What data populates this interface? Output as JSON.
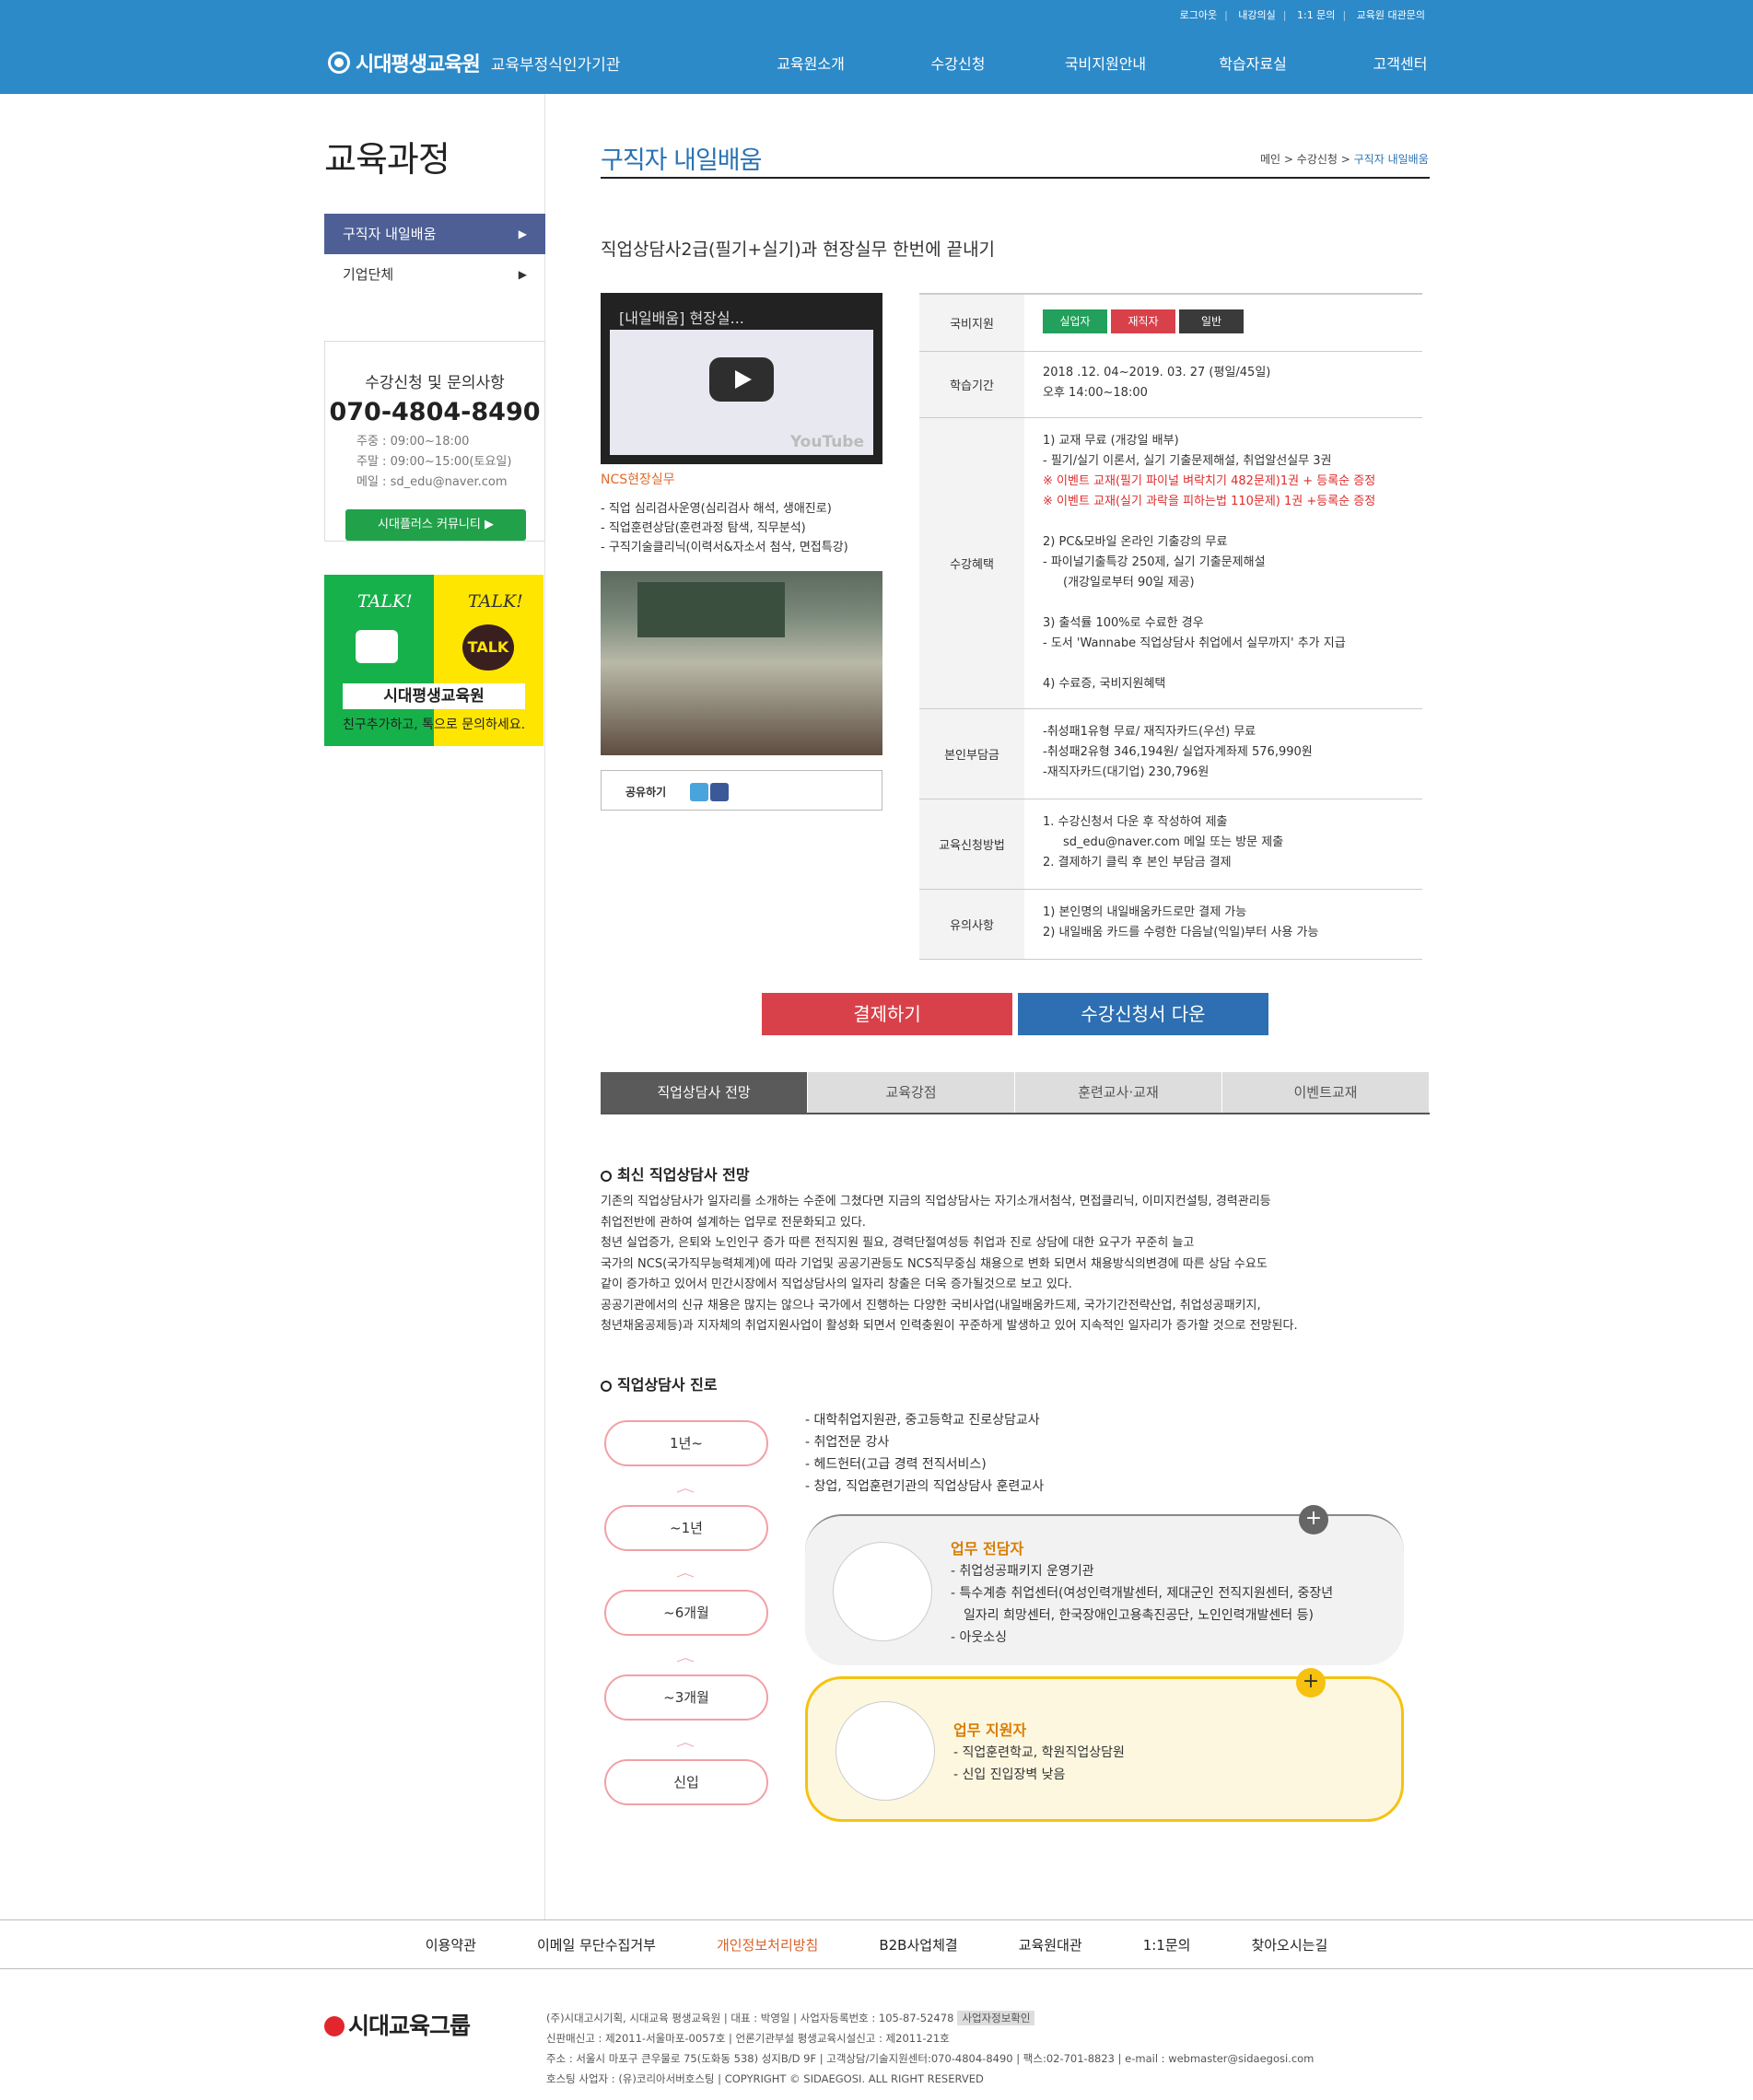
{
  "util": [
    "로그아웃",
    "내강의실",
    "1:1 문의",
    "교육원 대관문의"
  ],
  "logo": {
    "name": "시대평생교육원",
    "sub": "교육부정식인가기관"
  },
  "gnb": [
    "교육원소개",
    "수강신청",
    "국비지원안내",
    "학습자료실",
    "고객센터"
  ],
  "lnb": {
    "title": "교육과정",
    "items": [
      "구직자 내일배움",
      "기업단체"
    ]
  },
  "inquiry": {
    "title": "수강신청 및 문의사항",
    "phone": "070-4804-8490",
    "weekday": "주중 : 09:00~18:00",
    "weekend": "주말 : 09:00~15:00(토요일)",
    "email": "메일 : sd_edu@naver.com",
    "community": "시대플러스 커뮤니티 ▶"
  },
  "talk": {
    "left": "TALK!",
    "right": "TALK!",
    "icon": "TALK",
    "name": "시대평생교육원",
    "caption": "친구추가하고, 톡으로 문의하세요."
  },
  "page": {
    "title": "구직자 내일배움",
    "crumb": [
      "메인",
      "수강신청",
      "구직자 내일배움"
    ]
  },
  "course": {
    "title": "직업상담사2급(필기+실기)과 현장실무 한번에 끝내기",
    "video_title": "[내일배움] 현장실...",
    "ncs": "NCS현장실무",
    "list": [
      "- 직업 심리검사운영(심리검사 해석, 생애진로)",
      "- 직업훈련상담(훈련과정 탐색, 직무분석)",
      "- 구직기술클리닉(이력서&자소서 첨삭, 면접특강)"
    ],
    "share": "공유하기"
  },
  "info": {
    "support_label": "국비지원",
    "badges": [
      "실업자",
      "재직자",
      "일반"
    ],
    "period_label": "학습기간",
    "period": [
      "2018 .12. 04~2019. 03. 27 (평일/45일)",
      "오후 14:00~18:00"
    ],
    "benefit_label": "수강혜택",
    "benefit1": [
      "1) 교재 무료 (개강일 배부)",
      "- 필기/실기 이론서, 실기 기출문제해설, 취업알선실무 3권"
    ],
    "benefit1_red": [
      "※ 이벤트 교재(필기 파이널 벼락치기 482문제)1권 + 등록순 증정",
      "※ 이벤트 교재(실기 과락을 피하는법 110문제) 1권 +등록순 증정"
    ],
    "benefit2": [
      "2) PC&모바일 온라인 기출강의 무료",
      "- 파이널기출특강 250제, 실기 기출문제해설",
      "(개강일로부터 90일 제공)"
    ],
    "benefit3": [
      "3) 출석률 100%로 수료한 경우",
      "- 도서 'Wannabe 직업상담사 취업에서 실무까지' 추가 지급"
    ],
    "benefit4": "4) 수료증, 국비지원혜택",
    "cost_label": "본인부담금",
    "cost": [
      "-취성패1유형 무료/ 재직자카드(우선) 무료",
      "-취성패2유형 346,194원/ 실업자계좌제 576,990원",
      "-재직자카드(대기업) 230,796원"
    ],
    "apply_label": "교육신청방법",
    "apply": [
      "1. 수강신청서 다운 후 작성하여 제출",
      "sd_edu@naver.com 메일 또는 방문 제출",
      "2. 결제하기 클릭 후 본인 부담금 결제"
    ],
    "note_label": "유의사항",
    "note": [
      "1) 본인명의 내일배움카드로만 결제 가능",
      "2) 내일배움 카드를 수령한 다음날(익일)부터 사용 가능"
    ]
  },
  "buttons": {
    "pay": "결제하기",
    "download": "수강신청서 다운"
  },
  "tabs": [
    "직업상담사 전망",
    "교육강점",
    "훈련교사·교재",
    "이벤트교재"
  ],
  "outlook": {
    "title": "최신 직업상담사 전망",
    "lines": [
      "기존의 직업상담사가 일자리를 소개하는 수준에 그쳤다면 지금의 직업상담사는 자기소개서첨삭, 면접클리닉, 이미지컨설팅, 경력관리등",
      "취업전반에 관하여 설계하는 업무로 전문화되고 있다.",
      "청년 실업증가, 은퇴와 노인인구 증가 따른 전직지원 필요, 경력단절여성등 취업과 진로 상담에 대한 요구가 꾸준히 늘고",
      "국가의 NCS(국가직무능력체계)에 따라 기업및 공공기관등도 NCS직무중심 채용으로 변화 되면서 채용방식의변경에 따른 상담 수요도",
      "같이 증가하고 있어서 민간시장에서 직업상담사의 일자리 창출은 더욱 증가될것으로 보고 있다.",
      "공공기관에서의 신규 채용은 많지는 않으나 국가에서 진행하는 다양한 국비사업(내일배움카드제, 국가기간전략산업, 취업성공패키지,",
      "청년채움공제등)과 지자체의 취업지원사업이 활성화 되면서 인력충원이 꾸준하게 발생하고 있어 지속적인 일자리가 증가할 것으로 전망된다."
    ]
  },
  "career": {
    "title": "직업상담사 진로",
    "steps": [
      "1년~",
      "~1년",
      "~6개월",
      "~3개월",
      "신입"
    ],
    "paths": [
      "- 대학취업지원관, 중고등학교 진로상담교사",
      "- 취업전문 강사",
      "- 헤드헌터(고급 경력 전직서비스)",
      "- 창업, 직업훈련기관의 직업상담사 훈련교사"
    ],
    "card1": {
      "title": "업무 전담자",
      "lines": [
        "- 취업성공패키지 운영기관",
        "- 특수계층 취업센터(여성인력개발센터, 제대군인 전직지원센터, 중장년",
        "일자리 희망센터, 한국장애인고용촉진공단, 노인인력개발센터 등)",
        "- 아웃소싱"
      ]
    },
    "card2": {
      "title": "업무 지원자",
      "lines": [
        "- 직업훈련학교, 학원직업상담원",
        "- 신입 진입장벽 낮음"
      ]
    }
  },
  "footer": {
    "links": [
      "이용약관",
      "이메일 무단수집거부",
      "개인정보처리방침",
      "B2B사업체결",
      "교육원대관",
      "1:1문의",
      "찾아오시는길"
    ],
    "logo": "시대교육그룹",
    "lines": [
      "(주)시대고시기획, 시대교육 평생교육원 | 대표 : 박영일 | 사업자등록번호 : 105-87-52478",
      "신판매신고 : 제2011-서울마포-0057호 | 언론기관부설 평생교육시설신고 : 제2011-21호",
      "주소 : 서울시 마포구 큰우물로 75(도화동 538) 성지B/D 9F | 고객상담/기술지원센터:070-4804-8490 | 팩스:02-701-8823 | e-mail : webmaster@sidaegosi.com",
      "호스팅 사업자 : (유)코리아서버호스팅 | COPYRIGHT © SIDAEGOSI. ALL RIGHT RESERVED"
    ],
    "tag": "사업자정보확인"
  },
  "colors": {
    "brand": "#2d8ac9",
    "lnb_active": "#4d5f95",
    "pay": "#d9414a",
    "download": "#2d6fb2",
    "green": "#16b14a",
    "yellow": "#ffe600"
  }
}
